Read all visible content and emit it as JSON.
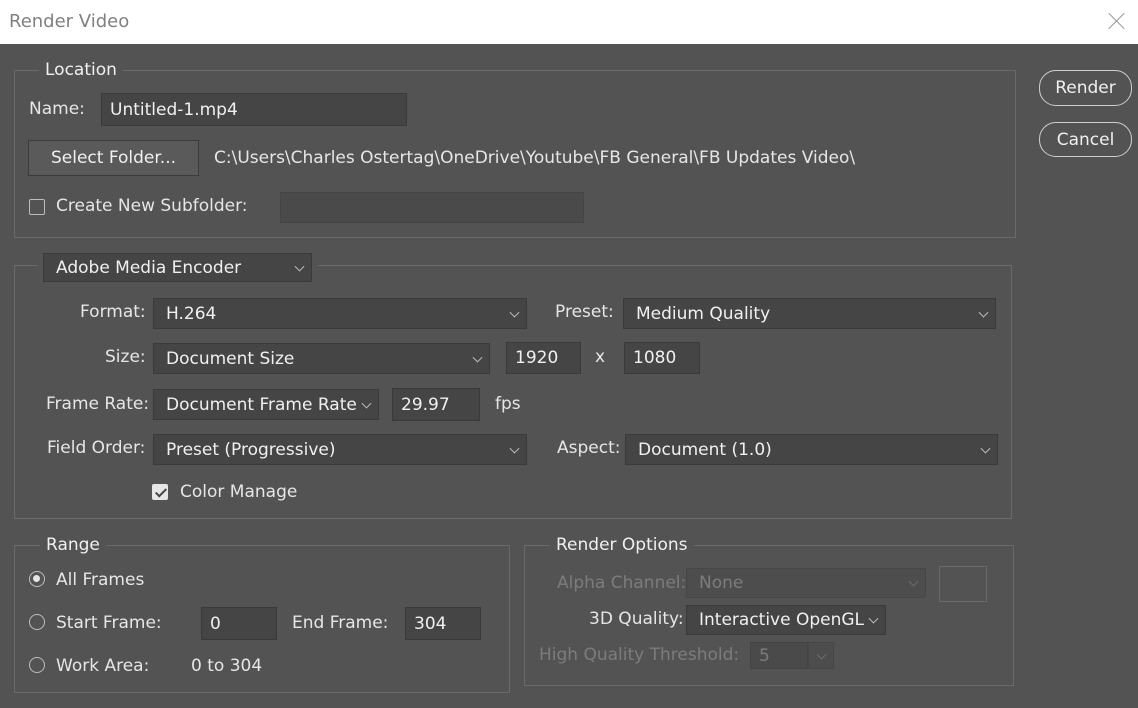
{
  "window": {
    "title": "Render Video"
  },
  "buttons": {
    "render": "Render",
    "cancel": "Cancel"
  },
  "location": {
    "legend": "Location",
    "name_label": "Name:",
    "name_value": "Untitled-1.mp4",
    "select_folder": "Select Folder...",
    "path": "C:\\Users\\Charles Ostertag\\OneDrive\\Youtube\\FB General\\FB Updates Video\\",
    "subfolder_label": "Create New Subfolder:",
    "subfolder_checked": false,
    "subfolder_value": ""
  },
  "encoder": {
    "selected": "Adobe Media Encoder",
    "format_label": "Format:",
    "format_value": "H.264",
    "preset_label": "Preset:",
    "preset_value": "Medium Quality",
    "size_label": "Size:",
    "size_value": "Document Size",
    "width": "1920",
    "x_sep": "x",
    "height": "1080",
    "frame_rate_label": "Frame Rate:",
    "frame_rate_value": "Document Frame Rate",
    "fps_value": "29.97",
    "fps_unit": "fps",
    "field_order_label": "Field Order:",
    "field_order_value": "Preset (Progressive)",
    "aspect_label": "Aspect:",
    "aspect_value": "Document (1.0)",
    "color_manage_label": "Color Manage",
    "color_manage_checked": true
  },
  "range": {
    "legend": "Range",
    "all_frames": "All Frames",
    "start_frame_label": "Start Frame:",
    "start_frame_value": "0",
    "end_frame_label": "End Frame:",
    "end_frame_value": "304",
    "work_area_label": "Work Area:",
    "work_area_value": "0 to 304",
    "selected": "All Frames"
  },
  "render_options": {
    "legend": "Render Options",
    "alpha_label": "Alpha Channel:",
    "alpha_value": "None",
    "quality_label": "3D Quality:",
    "quality_value": "Interactive OpenGL",
    "threshold_label": "High Quality Threshold:",
    "threshold_value": "5"
  }
}
